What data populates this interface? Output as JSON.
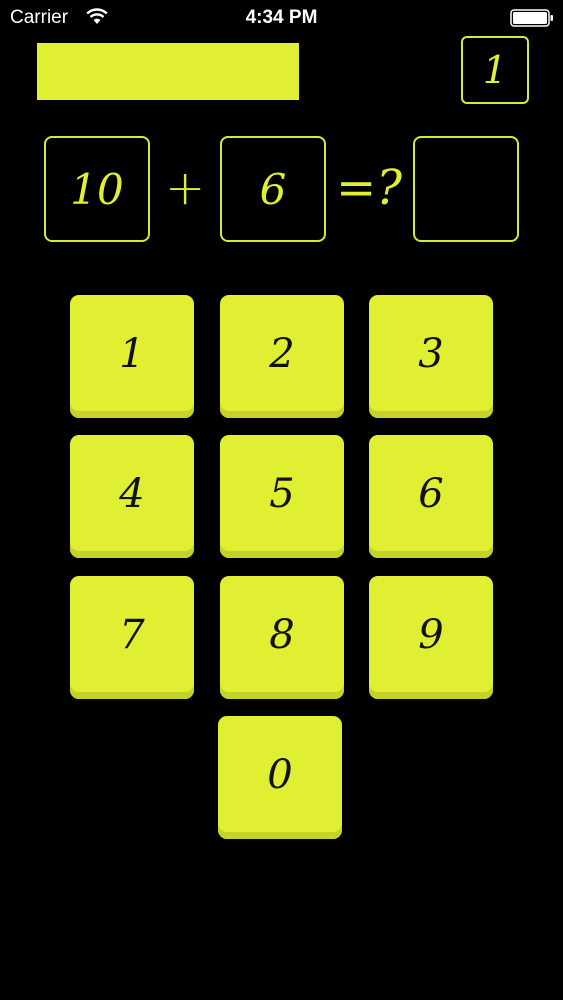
{
  "status_bar": {
    "carrier": "Carrier",
    "time": "4:34 PM",
    "wifi_icon": "wifi-icon",
    "battery_icon": "battery-icon"
  },
  "header": {
    "progress_fraction": 1.0,
    "level": "1"
  },
  "equation": {
    "operand_a": "10",
    "operator": "+",
    "operand_b": "6",
    "equals": "=?",
    "answer": ""
  },
  "keypad": {
    "keys": [
      "1",
      "2",
      "3",
      "4",
      "5",
      "6",
      "7",
      "8",
      "9",
      "0"
    ]
  },
  "colors": {
    "background": "#000000",
    "accent": "#e1ef33",
    "key_text": "#111111"
  }
}
